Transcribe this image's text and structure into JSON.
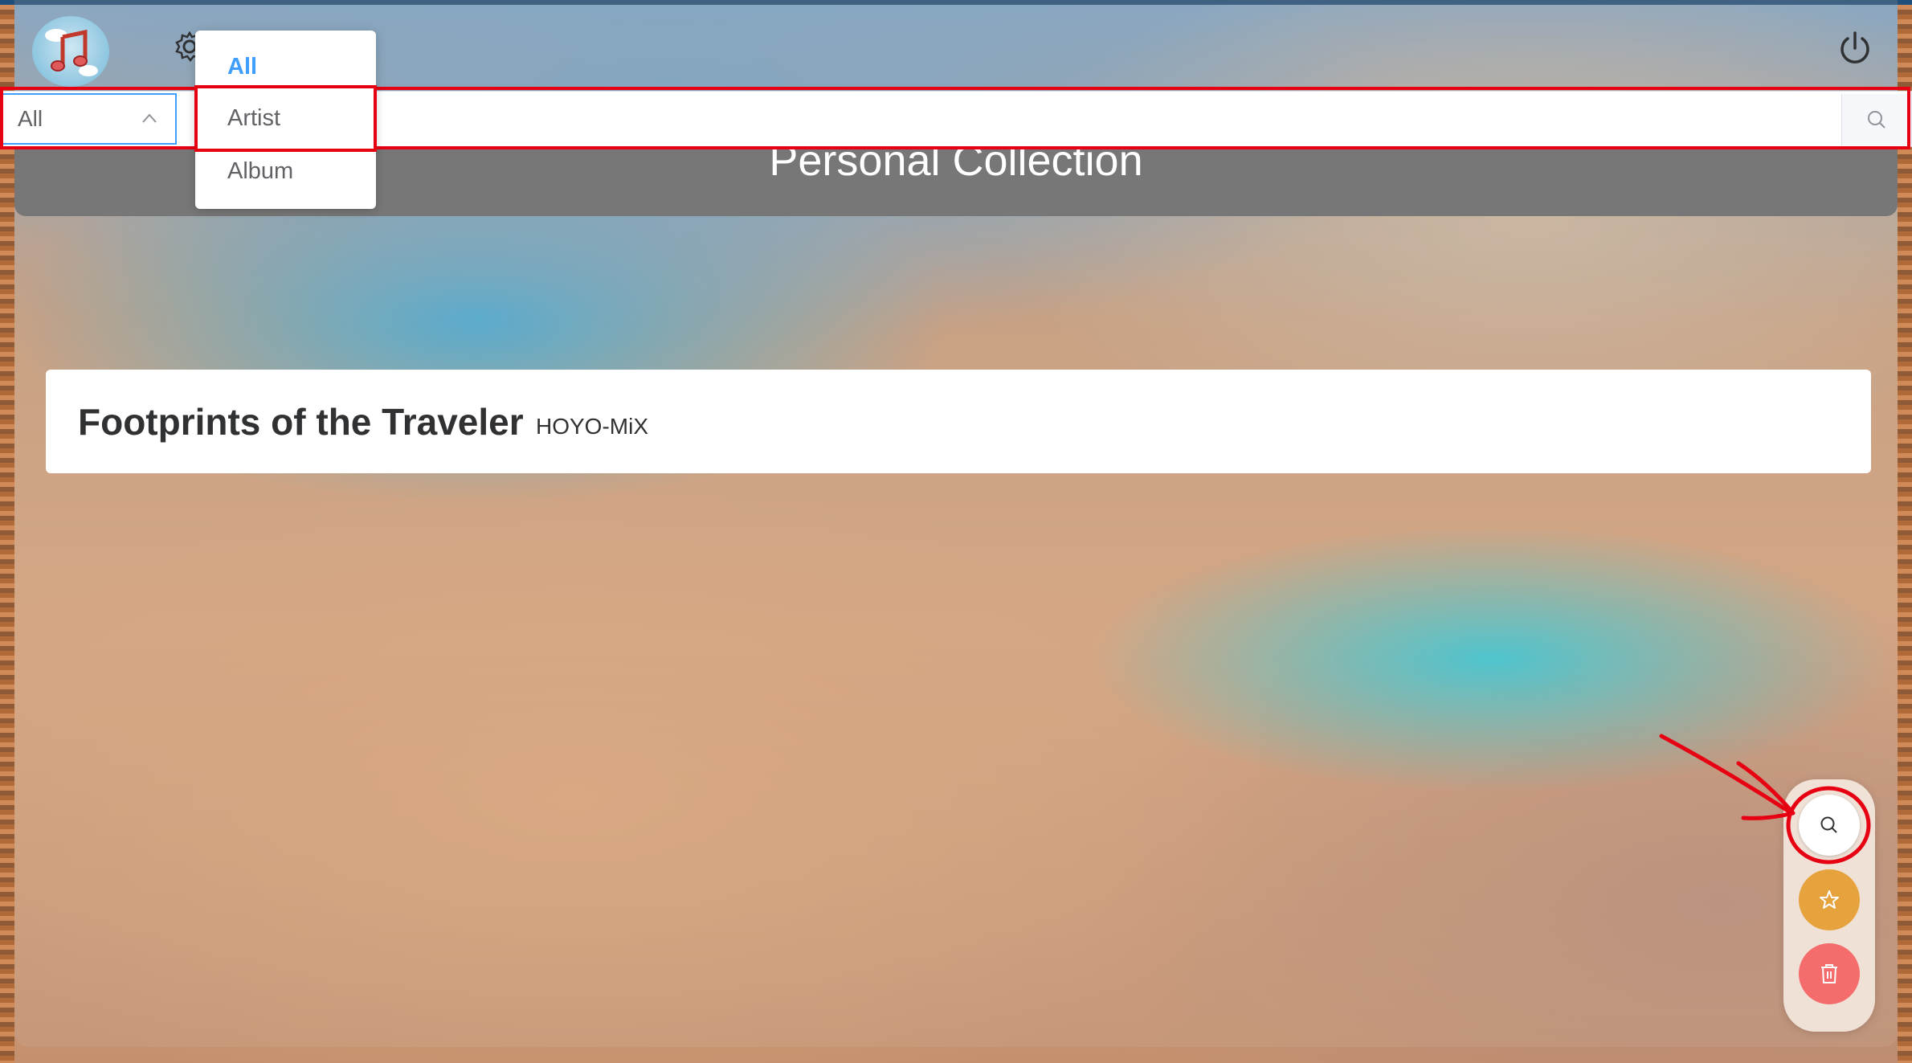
{
  "app": {
    "logo_icon": "music-notes-cloud-icon",
    "settings_icon": "gear-icon",
    "power_icon": "power-icon"
  },
  "search": {
    "filter_value": "All",
    "placeholder": "",
    "search_icon": "search-icon",
    "filter_options": [
      {
        "label": "All",
        "selected": true
      },
      {
        "label": "Artist",
        "selected": false
      },
      {
        "label": "Album",
        "selected": false
      }
    ]
  },
  "collection": {
    "title": "Personal Collection"
  },
  "songs": [
    {
      "title": "Footprints of the Traveler",
      "artist": "HOYO-MiX"
    }
  ],
  "actions": [
    {
      "name": "search",
      "icon": "search-icon",
      "color": "#ffffff"
    },
    {
      "name": "favorite",
      "icon": "star-icon",
      "color": "#e6a23c"
    },
    {
      "name": "delete",
      "icon": "trash-icon",
      "color": "#f56c6c"
    }
  ],
  "colors": {
    "accent": "#409eff",
    "annotation": "#e60012",
    "header_bg": "#777777"
  }
}
